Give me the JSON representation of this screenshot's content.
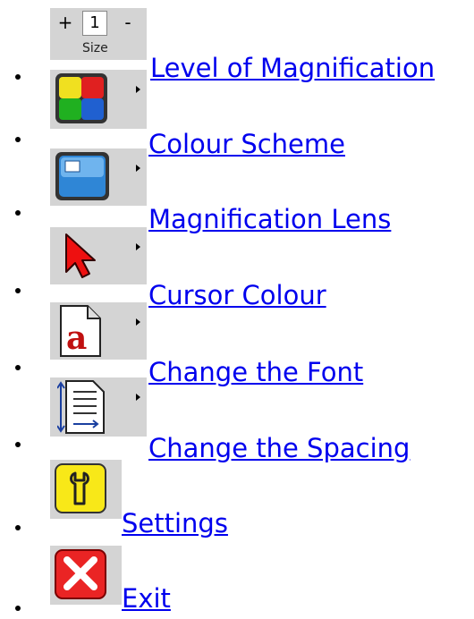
{
  "size_control": {
    "plus": "+",
    "value": "1",
    "minus": "-",
    "label": "Size"
  },
  "items": [
    {
      "label": "Level of Magnification",
      "icon": "size-control-icon"
    },
    {
      "label": "Colour Scheme",
      "icon": "colour-scheme-icon"
    },
    {
      "label": "Magnification Lens",
      "icon": "magnification-lens-icon"
    },
    {
      "label": "Cursor Colour",
      "icon": "cursor-icon"
    },
    {
      "label": "Change the Font",
      "icon": "font-icon"
    },
    {
      "label": "Change the Spacing",
      "icon": "spacing-icon"
    },
    {
      "label": "Settings",
      "icon": "settings-icon"
    },
    {
      "label": "Exit",
      "icon": "exit-icon"
    }
  ],
  "colors": {
    "link": "#0000ee",
    "tile": "#d4d4d4"
  }
}
